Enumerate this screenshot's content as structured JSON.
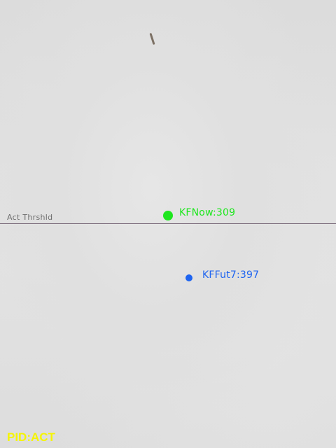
{
  "threshold": {
    "label": "Act Thrshld",
    "line_color": "#7a6a7a"
  },
  "markers": {
    "kf_now": {
      "label": "KFNow:309",
      "color": "#1ee61e"
    },
    "kf_future": {
      "label": "KFFut7:397",
      "color": "#1e64f0"
    }
  },
  "status": {
    "pid_label": "PID:ACT",
    "color": "#f5f500"
  }
}
